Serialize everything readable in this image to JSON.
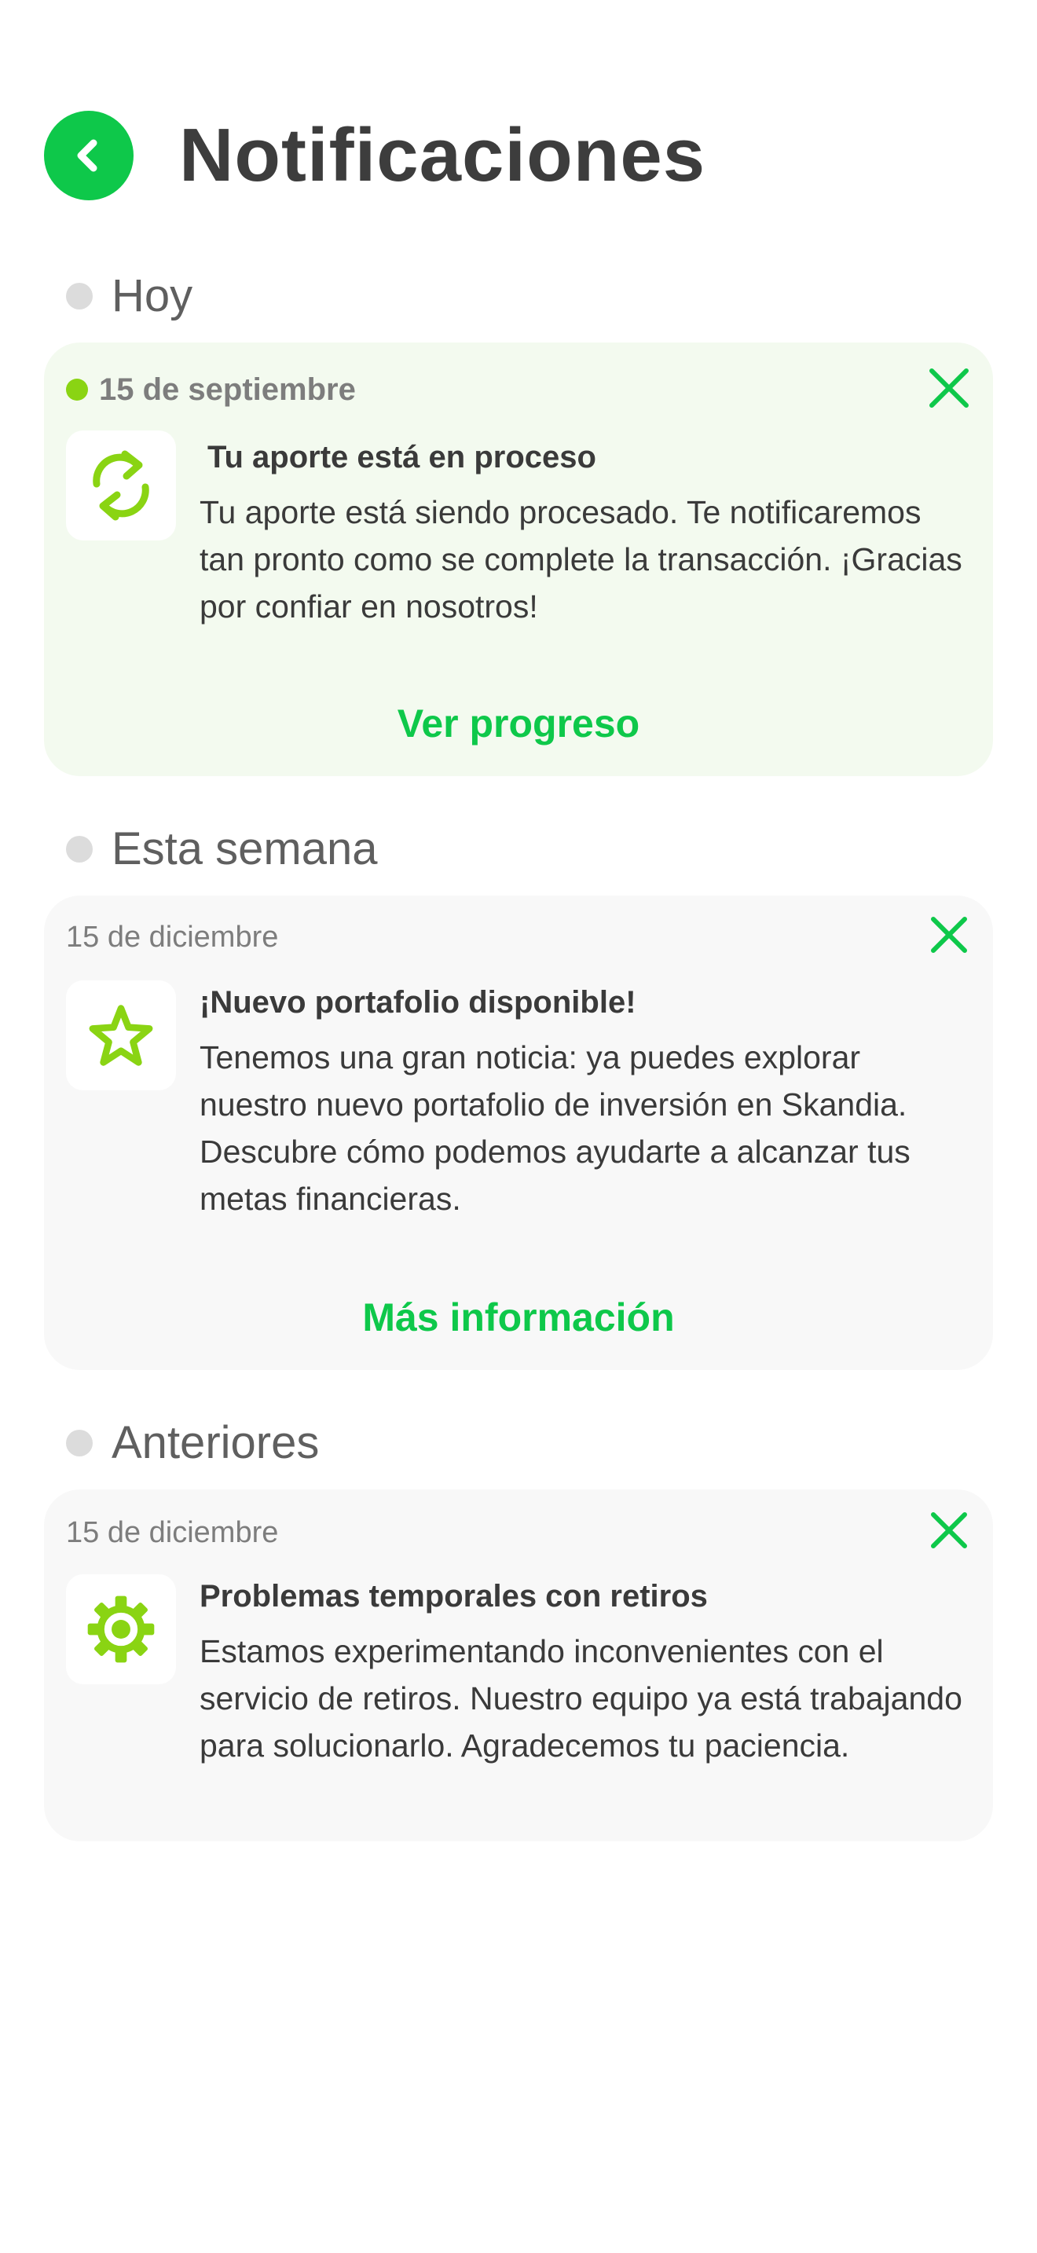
{
  "header": {
    "title": "Notificaciones",
    "back_icon": "chevron-left-icon"
  },
  "colors": {
    "brand_green": "#0ec84a",
    "accent_lime": "#8ad413",
    "active_card_bg": "#f3faef",
    "read_card_bg": "#f8f8f8"
  },
  "sections": [
    {
      "label": "Hoy",
      "notifications": [
        {
          "date": "15 de septiembre",
          "unread": true,
          "icon": "refresh-icon",
          "title": "Tu aporte está en proceso",
          "body": "Tu aporte está siendo procesado. Te notificaremos tan pronto como se complete la transacción. ¡Gracias por confiar en nosotros!",
          "action": "Ver progreso"
        }
      ]
    },
    {
      "label": "Esta semana",
      "notifications": [
        {
          "date": "15 de diciembre",
          "unread": false,
          "icon": "star-icon",
          "title": "¡Nuevo portafolio disponible!",
          "body": "Tenemos una gran noticia: ya puedes explorar nuestro nuevo portafolio de inversión en Skandia. Descubre cómo podemos ayudarte a alcanzar tus metas financieras.",
          "action": "Más información"
        }
      ]
    },
    {
      "label": "Anteriores",
      "notifications": [
        {
          "date": "15 de diciembre",
          "unread": false,
          "icon": "gear-icon",
          "title": "Problemas temporales con retiros",
          "body": "Estamos experimentando inconvenientes con el servicio de retiros. Nuestro equipo ya está trabajando para solucionarlo. Agradecemos tu paciencia."
        }
      ]
    }
  ]
}
